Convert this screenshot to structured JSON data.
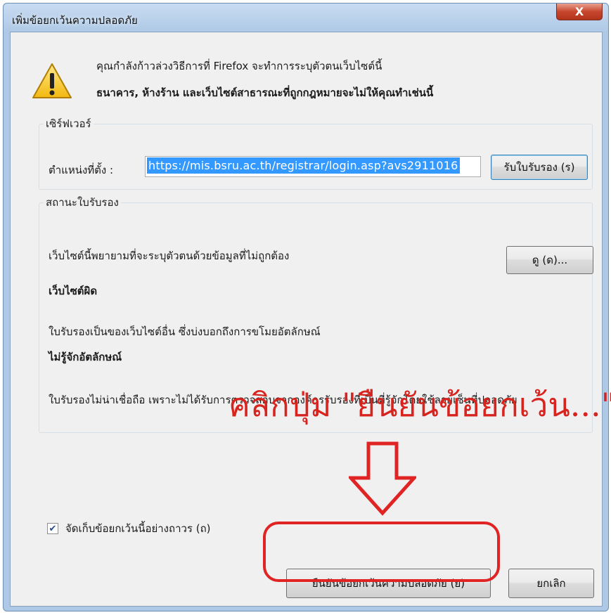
{
  "dialog": {
    "title": "เพิ่มข้อยกเว้นความปลอดภัย",
    "close_label": "X",
    "warning_line1": "คุณกำลังก้าวล่วงวิธีการที่ Firefox จะทำการระบุตัวตนเว็บไซต์นี้",
    "warning_line2": "ธนาคาร, ห้างร้าน และเว็บไซต์สาธารณะที่ถูกกฎหมายจะไม่ให้คุณทำเช่นนี้"
  },
  "server": {
    "legend": "เซิร์ฟเวอร์",
    "location_label": "ตำแหน่งที่ตั้ง :",
    "url_value": "https://mis.bsru.ac.th/registrar/login.asp?avs2911016",
    "get_cert_button": "รับใบรับรอง (ร)"
  },
  "cert_status": {
    "legend": "สถานะใบรับรอง",
    "line1": "เว็บไซต์นี้พยายามที่จะระบุตัวตนด้วยข้อมูลที่ไม่ถูกต้อง",
    "view_button": "ดู (ด)...",
    "wrong_site_heading": "เว็บไซต์ผิด",
    "wrong_site_text": "ใบรับรองเป็นของเว็บไซต์อื่น ซึ่งบ่งบอกถึงการขโมยอัตลักษณ์",
    "unknown_identity_heading": "ไม่รู้จักอัตลักษณ์",
    "unknown_identity_text": "ใบรับรองไม่น่าเชื่อถือ เพราะไม่ได้รับการตรวจสอบจากองค์กรรับรองที่เป็นที่รู้จักโดยใช้ลายเซ็นที่ปลอดภัย"
  },
  "annotation": {
    "text": "คลิกปุ่ม \"ยืนยันข้อยกเว้น...\"",
    "color": "#d8241f"
  },
  "footer": {
    "store_checkbox_label": "จัดเก็บข้อยกเว้นนี้อย่างถาวร (ถ)",
    "store_checked": true,
    "confirm_button": "ยืนยันข้อยกเว้นความปลอดภัย (ย)",
    "cancel_button": "ยกเลิก"
  },
  "icons": {
    "warning": "warning-icon",
    "close": "close-icon",
    "check": "check-icon",
    "arrow": "down-arrow-icon"
  }
}
